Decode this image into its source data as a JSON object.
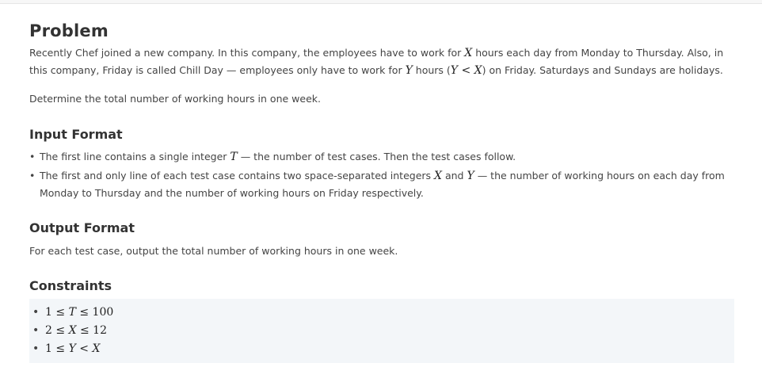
{
  "problem": {
    "title": "Problem",
    "p1": {
      "a": "Recently Chef joined a new company. In this company, the employees have to work for ",
      "x": "X",
      "b": " hours each day from Monday to Thursday. Also, in this company, Friday is called Chill Day — employees only have to work for ",
      "y": "Y",
      "c": " hours (",
      "cond_y": "Y",
      "cond_lt": " < ",
      "cond_x": "X",
      "d": ") on Friday. Saturdays and Sundays are holidays."
    },
    "p2": "Determine the total number of working hours in one week."
  },
  "input_format": {
    "title": "Input Format",
    "item1": {
      "a": "The first line contains a single integer ",
      "t": "T",
      "b": " — the number of test cases. Then the test cases follow."
    },
    "item2": {
      "a": "The first and only line of each test case contains two space-separated integers ",
      "x": "X",
      "b": " and ",
      "y": "Y",
      "c": " — the number of working hours on each day from Monday to Thursday and the number of working hours on Friday respectively."
    }
  },
  "output_format": {
    "title": "Output Format",
    "text": "For each test case, output the total number of working hours in one week."
  },
  "constraints": {
    "title": "Constraints",
    "items": [
      {
        "low": "1",
        "op1": " ≤ ",
        "var": "T",
        "op2": " ≤ ",
        "high": "100"
      },
      {
        "low": "2",
        "op1": " ≤ ",
        "var": "X",
        "op2": " ≤ ",
        "high": "12"
      },
      {
        "low": "1",
        "op1": " ≤ ",
        "var": "Y",
        "op2": " < ",
        "high": "X"
      }
    ]
  }
}
